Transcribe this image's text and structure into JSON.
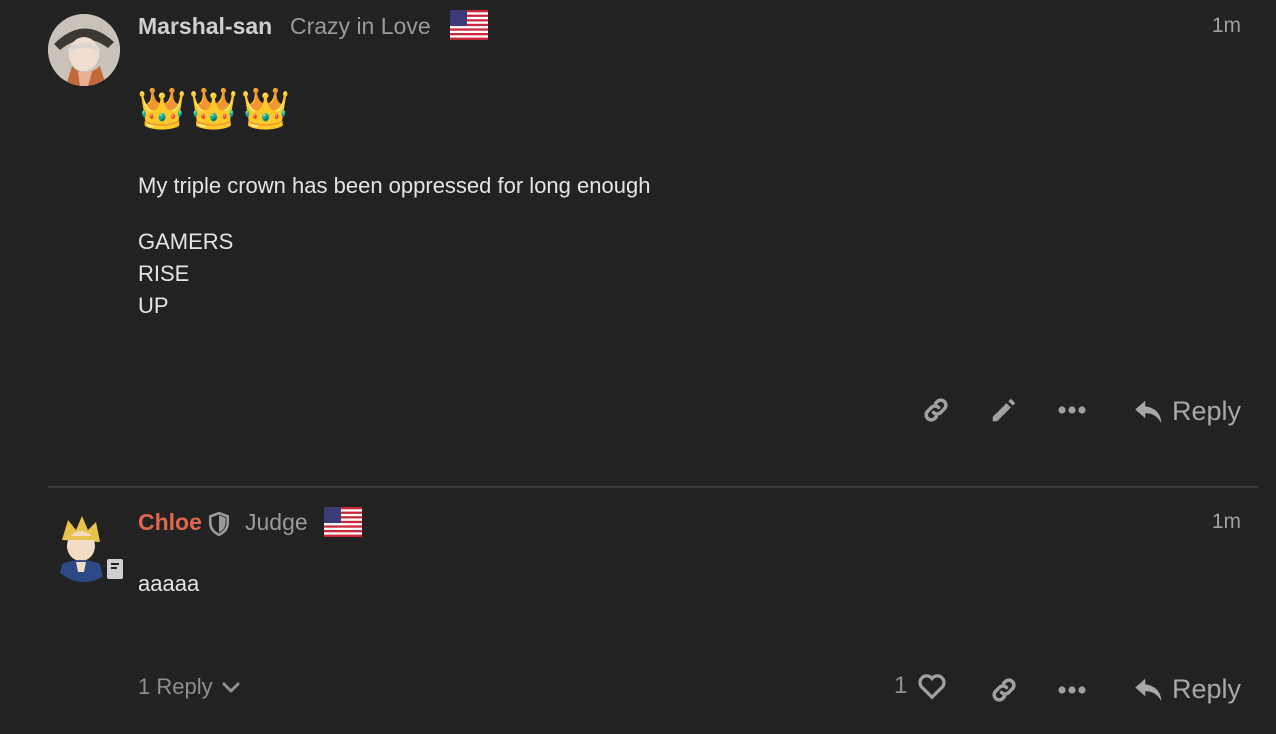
{
  "colors": {
    "background": "#222222",
    "username_default": "#cfcfcf",
    "username_staff": "#e0664f",
    "muted": "#9a9a9a"
  },
  "post1": {
    "username": "Marshal-san",
    "user_title": "Crazy in Love",
    "timestamp": "1m",
    "emoji": "👑👑👑",
    "paragraph": "My triple crown has been oppressed for long enough",
    "lines": [
      "GAMERS",
      "RISE",
      "UP"
    ],
    "reply_label": "Reply",
    "icons": [
      "link-icon",
      "pencil-icon",
      "more-icon",
      "reply-icon"
    ]
  },
  "post2": {
    "username": "Chloe",
    "user_title": "Judge",
    "timestamp": "1m",
    "body": "aaaaa",
    "replies_label": "1 Reply",
    "like_count": "1",
    "reply_label": "Reply",
    "icons": [
      "shield-icon",
      "book-badge-icon",
      "chevron-down-icon",
      "heart-icon",
      "link-icon",
      "more-icon",
      "reply-icon"
    ]
  }
}
